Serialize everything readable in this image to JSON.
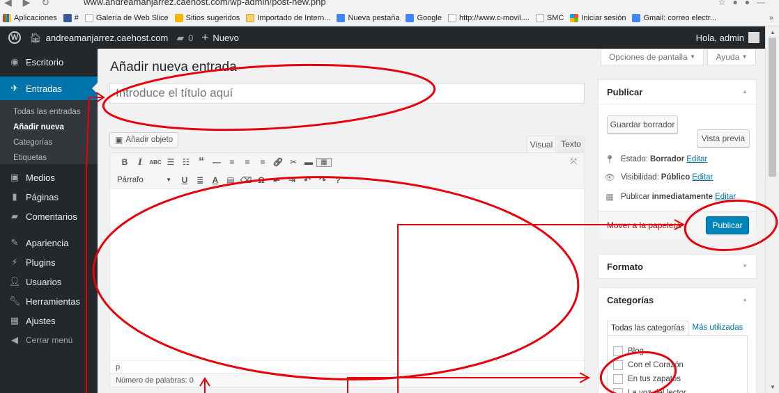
{
  "browser": {
    "url": "www.andreamanjarrez.caehost.com/wp-admin/post-new.php",
    "bookmarks": [
      {
        "label": "Aplicaciones",
        "icon": "apps"
      },
      {
        "label": "#",
        "icon": "fb"
      },
      {
        "label": "Galería de Web Slice",
        "icon": "page"
      },
      {
        "label": "Sitios sugeridos",
        "icon": "bing"
      },
      {
        "label": "Importado de Intern...",
        "icon": "folder"
      },
      {
        "label": "Nueva pestaña",
        "icon": "google"
      },
      {
        "label": "Google",
        "icon": "google"
      },
      {
        "label": "http://www.c-movil....",
        "icon": "page"
      },
      {
        "label": "SMC",
        "icon": "page"
      },
      {
        "label": "Iniciar sesión",
        "icon": "ms"
      },
      {
        "label": "Gmail: correo electr...",
        "icon": "google"
      }
    ],
    "more": "»"
  },
  "adminbar": {
    "site_name": "andreamanjarrez.caehost.com",
    "comments_count": "0",
    "new_label": "Nuevo",
    "greeting": "Hola, admin"
  },
  "sidebar": {
    "items": [
      {
        "label": "Escritorio",
        "icon": "dashboard-icon"
      },
      {
        "label": "Entradas",
        "icon": "pin-icon"
      },
      {
        "label": "Medios",
        "icon": "media-icon"
      },
      {
        "label": "Páginas",
        "icon": "page-icon"
      },
      {
        "label": "Comentarios",
        "icon": "comment-icon"
      },
      {
        "label": "Apariencia",
        "icon": "brush-icon"
      },
      {
        "label": "Plugins",
        "icon": "plugin-icon"
      },
      {
        "label": "Usuarios",
        "icon": "users-icon"
      },
      {
        "label": "Herramientas",
        "icon": "wrench-icon"
      },
      {
        "label": "Ajustes",
        "icon": "settings-icon"
      },
      {
        "label": "Cerrar menú",
        "icon": "collapse-icon"
      }
    ],
    "submenu": [
      "Todas las entradas",
      "Añadir nueva",
      "Categorías",
      "Etiquetas"
    ]
  },
  "screen_options": "Opciones de pantalla",
  "help": "Ayuda",
  "page_title": "Añadir nueva entrada",
  "title_placeholder": "Introduce el título aquí",
  "editor": {
    "add_media": "Añadir objeto",
    "tab_visual": "Visual",
    "tab_text": "Texto",
    "format": "Párrafo",
    "path": "p",
    "word_count": "Número de palabras: 0"
  },
  "publish": {
    "title": "Publicar",
    "save_draft": "Guardar borrador",
    "preview": "Vista previa",
    "status_label": "Estado:",
    "status_value": "Borrador",
    "visibility_label": "Visibilidad:",
    "visibility_value": "Público",
    "schedule_label": "Publicar",
    "schedule_value": "inmediatamente",
    "edit": "Editar",
    "trash": "Mover a la papelera",
    "publish_button": "Publicar"
  },
  "format_box": {
    "title": "Formato"
  },
  "categories_box": {
    "title": "Categorías",
    "tab_all": "Todas las categorías",
    "tab_popular": "Más utilizadas",
    "items": [
      "Blog",
      "Con el Corazón",
      "En tus zapatos",
      "La voz del lector"
    ]
  },
  "colors": {
    "accent": "#0073aa",
    "adminbar": "#23282d",
    "annotation": "#e8000b",
    "publish": "#0085ba"
  }
}
